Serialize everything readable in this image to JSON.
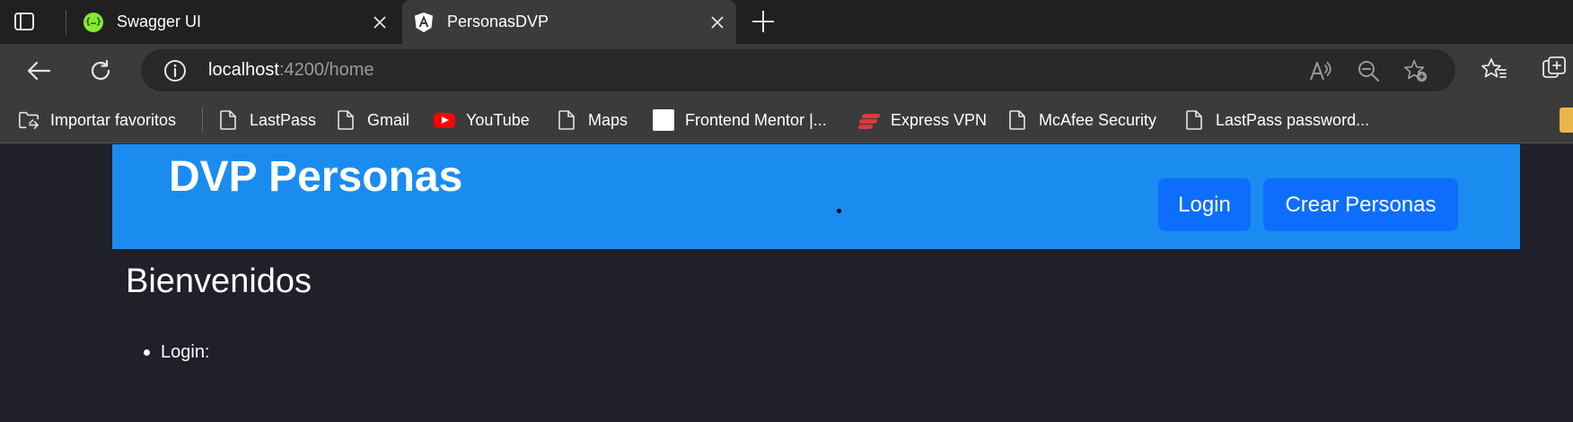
{
  "browser": {
    "tabs": [
      {
        "title": "Swagger UI",
        "icon": "swagger-icon",
        "active": false
      },
      {
        "title": "PersonasDVP",
        "icon": "angular-icon",
        "active": true
      }
    ],
    "url": {
      "host": "localhost",
      "rest": ":4200/home"
    },
    "bookmarks": [
      {
        "label": "Importar favoritos",
        "icon": "import-folder-icon"
      },
      {
        "label": "LastPass",
        "icon": "page-icon"
      },
      {
        "label": "Gmail",
        "icon": "page-icon"
      },
      {
        "label": "YouTube",
        "icon": "youtube-icon"
      },
      {
        "label": "Maps",
        "icon": "page-icon"
      },
      {
        "label": "Frontend Mentor |...",
        "icon": "frontend-mentor-icon"
      },
      {
        "label": "Express VPN",
        "icon": "expressvpn-icon"
      },
      {
        "label": "McAfee Security",
        "icon": "page-icon"
      },
      {
        "label": "LastPass password...",
        "icon": "page-icon"
      }
    ]
  },
  "app": {
    "brand": "DVP Personas",
    "nav": {
      "login": "Login",
      "create": "Crear Personas"
    },
    "heading": "Bienvenidos",
    "list": [
      "Login:"
    ]
  },
  "colors": {
    "navbar": "#1a8cf0",
    "button": "#0d6efd",
    "page_bg": "#1f2029"
  }
}
